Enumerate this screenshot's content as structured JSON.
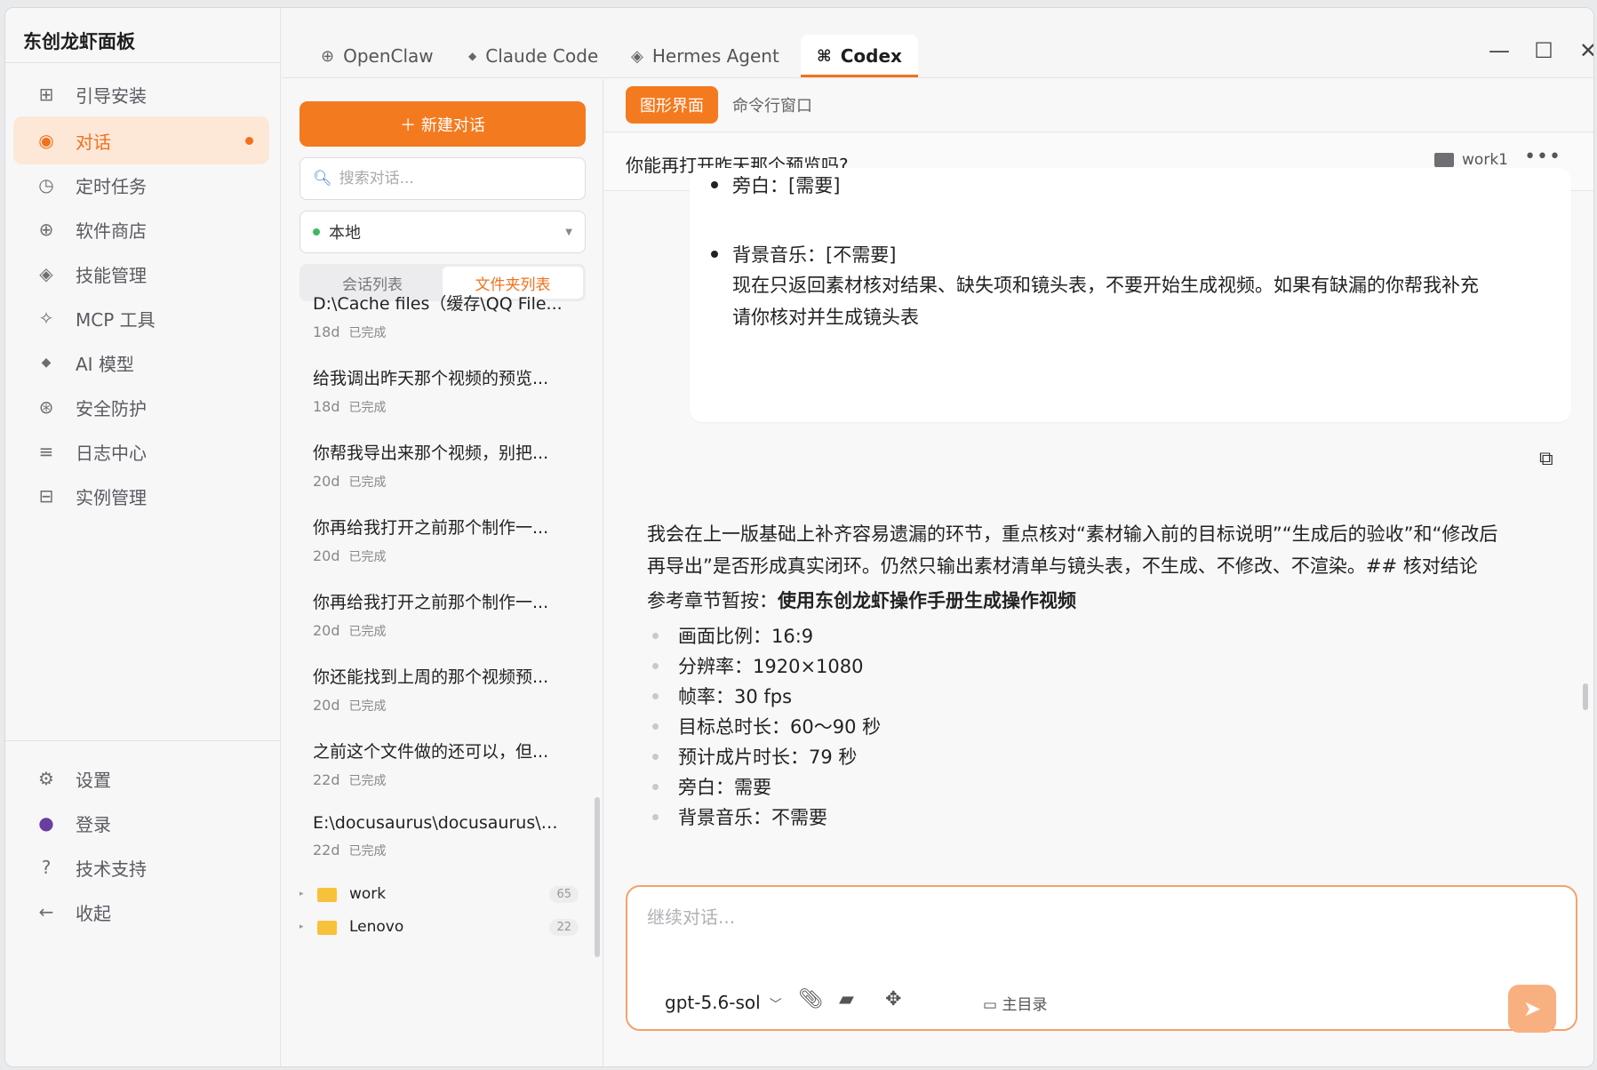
{
  "brand": "东创龙虾面板",
  "nav": [
    {
      "icon": "⊞",
      "label": "引导安装"
    },
    {
      "icon": "◉",
      "label": "对话"
    },
    {
      "icon": "◷",
      "label": "定时任务"
    },
    {
      "icon": "⊕",
      "label": "软件商店"
    },
    {
      "icon": "◈",
      "label": "技能管理"
    },
    {
      "icon": "✧",
      "label": "MCP 工具"
    },
    {
      "icon": "◆",
      "label": "AI 模型"
    },
    {
      "icon": "⊛",
      "label": "安全防护"
    },
    {
      "icon": "≡",
      "label": "日志中心"
    },
    {
      "icon": "⊟",
      "label": "实例管理"
    }
  ],
  "bottom_nav": [
    {
      "icon": "⚙",
      "label": "设置"
    },
    {
      "icon": "●",
      "label": "登录"
    },
    {
      "icon": "?",
      "label": "技术支持"
    },
    {
      "icon": "←",
      "label": "收起"
    }
  ],
  "tabs": [
    {
      "icon": "⊕",
      "label": "OpenClaw"
    },
    {
      "icon": "◆",
      "label": "Claude Code"
    },
    {
      "icon": "◈",
      "label": "Hermes Agent"
    },
    {
      "icon": "⌘",
      "label": "Codex"
    }
  ],
  "window": {
    "min": "—",
    "max": "☐",
    "close": "✕"
  },
  "mid": {
    "new_chat": "＋  新建对话",
    "search_placeholder": "搜索对话...",
    "source": "本地",
    "seg": [
      "会话列表",
      "文件夹列表"
    ]
  },
  "conversations": [
    {
      "title": "D:\\Cache files（缓存\\QQ File...",
      "age": "18d",
      "status": "已完成"
    },
    {
      "title": "给我调出昨天那个视频的预览...",
      "age": "18d",
      "status": "已完成"
    },
    {
      "title": "你帮我导出来那个视频，别把...",
      "age": "20d",
      "status": "已完成"
    },
    {
      "title": "你再给我打开之前那个制作一...",
      "age": "20d",
      "status": "已完成"
    },
    {
      "title": "你再给我打开之前那个制作一...",
      "age": "20d",
      "status": "已完成"
    },
    {
      "title": "你还能找到上周的那个视频预...",
      "age": "20d",
      "status": "已完成"
    },
    {
      "title": "之前这个文件做的还可以，但...",
      "age": "22d",
      "status": "已完成"
    },
    {
      "title": "E:\\docusaurus\\docusaurus\\d...",
      "age": "22d",
      "status": "已完成"
    }
  ],
  "folders": [
    {
      "name": "work",
      "count": "65"
    },
    {
      "name": "Lenovo",
      "count": "22"
    }
  ],
  "modes": [
    "图形界面",
    "命令行窗口"
  ],
  "chat": {
    "title": "你能再打开昨天那个预览吗?",
    "workspace": "work1",
    "more": "•••"
  },
  "card": {
    "item1": "旁白：[需要]",
    "item2": "背景音乐：[不需要]",
    "line2": "现在只返回素材核对结果、缺失项和镜头表，不要开始生成视频。如果有缺漏的你帮我补充",
    "line3": "请你核对并生成镜头表"
  },
  "answer": {
    "para1": "我会在上一版基础上补齐容易遗漏的环节，重点核对“素材输入前的目标说明”“生成后的验收”和“修改后",
    "para2": "再导出”是否形成真实闭环。仍然只输出素材清单与镜头表，不生成、不修改、不渲染。## 核对结论",
    "ref_label": "参考章节暂按：",
    "ref_bold": "使用东创龙虾操作手册生成操作视频",
    "items": [
      "画面比例：16:9",
      "分辨率：1920×1080",
      "帧率：30 fps",
      "目标总时长：60～90 秒",
      "预计成片时长：79 秒",
      "旁白：需要",
      "背景音乐：不需要"
    ]
  },
  "composer": {
    "placeholder": "继续对话...",
    "model": "gpt-5.6-sol",
    "home": "主目录"
  },
  "colors": {
    "accent": "#f47a1f",
    "accent_soft": "#fde8d8"
  }
}
